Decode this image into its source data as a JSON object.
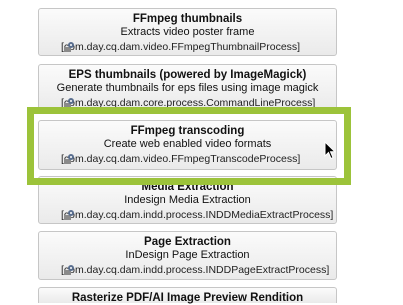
{
  "steps": [
    {
      "title": "FFmpeg thumbnails",
      "description": "Extracts video poster frame",
      "process": "[com.day.cq.dam.video.FFmpegThumbnailProcess]"
    },
    {
      "title": "EPS thumbnails (powered by ImageMagick)",
      "description": "Generate thumbnails for eps files using image magick",
      "process": "[com.day.cq.dam.core.process.CommandLineProcess]"
    },
    {
      "title": "FFmpeg transcoding",
      "description": "Create web enabled video formats",
      "process": "[com.day.cq.dam.video.FFmpegTranscodeProcess]"
    },
    {
      "title": "Media Extraction",
      "description": "Indesign Media Extraction",
      "process": "[com.day.cq.dam.indd.process.INDDMediaExtractProcess]"
    },
    {
      "title": "Page Extraction",
      "description": "InDesign Page Extraction",
      "process": "[com.day.cq.dam.indd.process.INDDPageExtractProcess]"
    },
    {
      "title": "Rasterize PDF/AI Image Preview Rendition",
      "description": "",
      "process": ""
    }
  ],
  "colors": {
    "highlight": "#9cc33a"
  },
  "icons": {
    "process": "process-gear-icon",
    "cursor": "mouse-pointer-icon"
  }
}
